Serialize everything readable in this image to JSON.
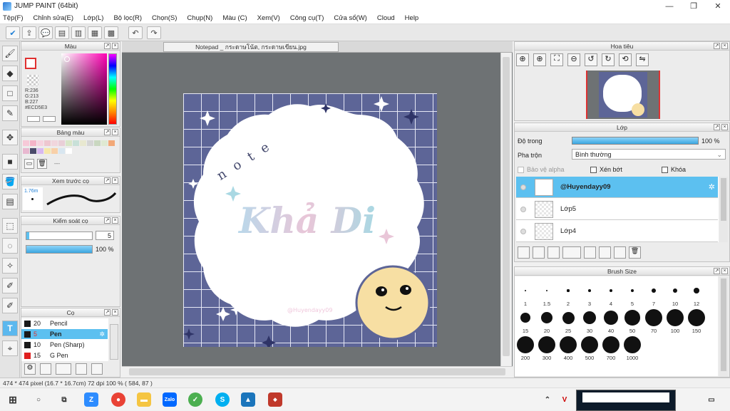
{
  "window": {
    "title": "JUMP PAINT (64bit)",
    "min": "—",
    "max": "❐",
    "close": "✕"
  },
  "menu": [
    "Tệp(F)",
    "Chỉnh sửa(E)",
    "Lớp(L)",
    "Bộ lọc(R)",
    "Chọn(S)",
    "Chụp(N)",
    "Màu (C)",
    "Xem(V)",
    "Công cụ(T)",
    "Cửa sổ(W)",
    "Cloud",
    "Help"
  ],
  "document_tab": "Notepad _ กระดาษโน้ต, กระดาษเขียน.jpg",
  "color_panel": {
    "title": "Màu",
    "r": "R:236",
    "g": "G:213",
    "b": "B:227",
    "hex": "#ECD5E3"
  },
  "palette_panel": {
    "title": "Bảng màu",
    "more": "---"
  },
  "preview_panel": {
    "title": "Xem trước cọ",
    "size": "1.76m"
  },
  "brush_control": {
    "title": "Kiểm soát cọ",
    "size_value": "5",
    "opacity_value": "100 %",
    "opacity_pct": 100
  },
  "brush_panel": {
    "title": "Cọ",
    "items": [
      {
        "num": "20",
        "name": "Pencil",
        "color": "#1a1a1a",
        "selected": false
      },
      {
        "num": "5",
        "name": "Pen",
        "color": "#1a1a1a",
        "selected": true
      },
      {
        "num": "10",
        "name": "Pen (Sharp)",
        "color": "#1a1a1a",
        "selected": false
      },
      {
        "num": "15",
        "name": "G Pen",
        "color": "#e02020",
        "selected": false
      }
    ]
  },
  "navigator": {
    "title": "Hoa tiêu"
  },
  "layer_panel": {
    "title": "Lớp",
    "opacity_label": "Độ trong",
    "opacity_value": "100 %",
    "opacity_pct": 100,
    "blend_label": "Pha trộn",
    "blend_value": "Bình thường",
    "protect_alpha": "Bảo vệ alpha",
    "clip": "Xén bớt",
    "lock": "Khóa",
    "layers": [
      {
        "name": "@Huyendayy09",
        "selected": true
      },
      {
        "name": "Lớp5",
        "selected": false
      },
      {
        "name": "Lớp4",
        "selected": false
      }
    ]
  },
  "brush_size": {
    "title": "Brush Size",
    "sizes": [
      "1",
      "1.5",
      "2",
      "3",
      "4",
      "5",
      "7",
      "10",
      "12",
      "15",
      "20",
      "25",
      "30",
      "40",
      "50",
      "70",
      "100",
      "150",
      "200",
      "300",
      "400",
      "500",
      "700",
      "1000"
    ]
  },
  "artwork": {
    "title_text": "note",
    "brand_text": "Khả Di",
    "watermark": "@Huyendayy09"
  },
  "status": "474 * 474 pixel   (16.7 * 16.7cm)   72 dpi   100 %   ( 584, 87 )",
  "colors": {
    "accent": "#5cc0f0",
    "frame": "#5d6597",
    "face": "#f7dfa3"
  }
}
